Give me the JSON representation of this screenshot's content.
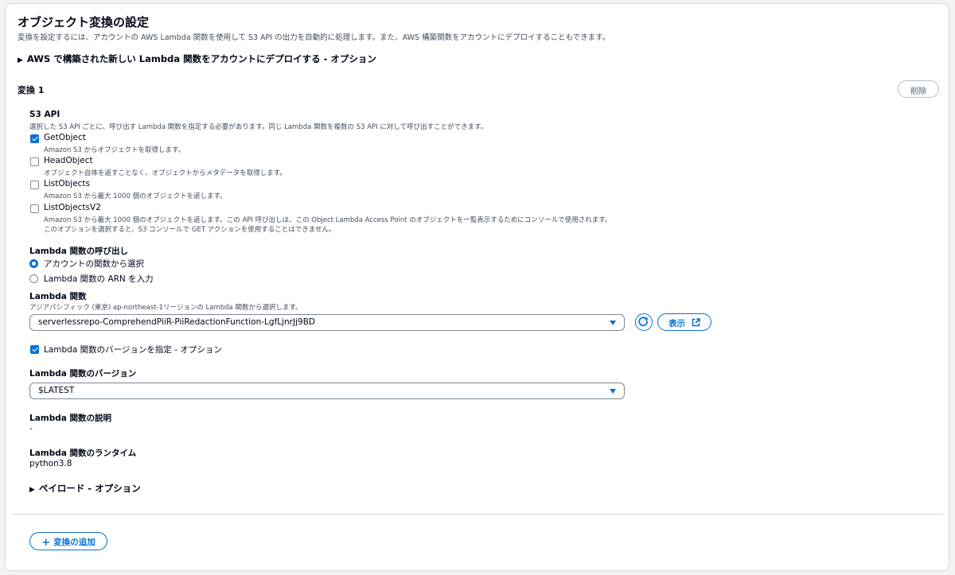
{
  "header": {
    "title": "オブジェクト変換の設定",
    "description": "変換を設定するには、アカウントの AWS Lambda 関数を使用して S3 API の出力を自動的に処理します。また、AWS 構築関数をアカウントにデプロイすることもできます。"
  },
  "deploy_expander": {
    "label": "AWS で構築された新しい Lambda 関数をアカウントにデプロイする - オプション"
  },
  "transform": {
    "title": "変換 1",
    "delete_label": "削除"
  },
  "s3_api": {
    "label": "S3 API",
    "description": "選択した S3 API ごとに、呼び出す Lambda 関数を指定する必要があります。同じ Lambda 関数を複数の S3 API に対して呼び出すことができます。",
    "options": [
      {
        "name": "GetObject",
        "checked": true,
        "description": "Amazon S3 からオブジェクトを取得します。"
      },
      {
        "name": "HeadObject",
        "checked": false,
        "description": "オブジェクト自体を返すことなく、オブジェクトからメタデータを取得します。"
      },
      {
        "name": "ListObjects",
        "checked": false,
        "description": "Amazon S3 から最大 1000 個のオブジェクトを返します。"
      },
      {
        "name": "ListObjectsV2",
        "checked": false,
        "description": "Amazon S3 から最大 1000 個のオブジェクトを返します。この API 呼び出しは、この Object Lambda Access Point のオブジェクトを一覧表示するためにコンソールで使用されます。",
        "description2": "このオプションを選択すると、S3 コンソールで GET アクションを使用することはできません。"
      }
    ]
  },
  "invoke": {
    "label": "Lambda 関数の呼び出し",
    "options": [
      {
        "label": "アカウントの関数から選択",
        "selected": true
      },
      {
        "label": "Lambda 関数の ARN を入力",
        "selected": false
      }
    ]
  },
  "lambda_function": {
    "label": "Lambda 関数",
    "description": "アジアパシフィック (東京) ap-northeast-1リージョンの Lambda 関数から選択します。",
    "selected": "serverlessrepo-ComprehendPiiR-PiiRedactionFunction-LgfLjnrJj9BD",
    "view_label": "表示"
  },
  "version_check": {
    "label": "Lambda 関数のバージョンを指定 - オプション",
    "checked": true
  },
  "version": {
    "label": "Lambda 関数のバージョン",
    "selected": "$LATEST"
  },
  "function_description": {
    "label": "Lambda 関数の説明",
    "value": "-"
  },
  "runtime": {
    "label": "Lambda 関数のランタイム",
    "value": "python3.8"
  },
  "payload_expander": {
    "label": "ペイロード - オプション"
  },
  "add_transform": {
    "label": "変換の追加"
  },
  "colors": {
    "accent": "#0972d3",
    "text": "#000716",
    "muted": "#414d5c",
    "border": "#d5dbdb"
  }
}
